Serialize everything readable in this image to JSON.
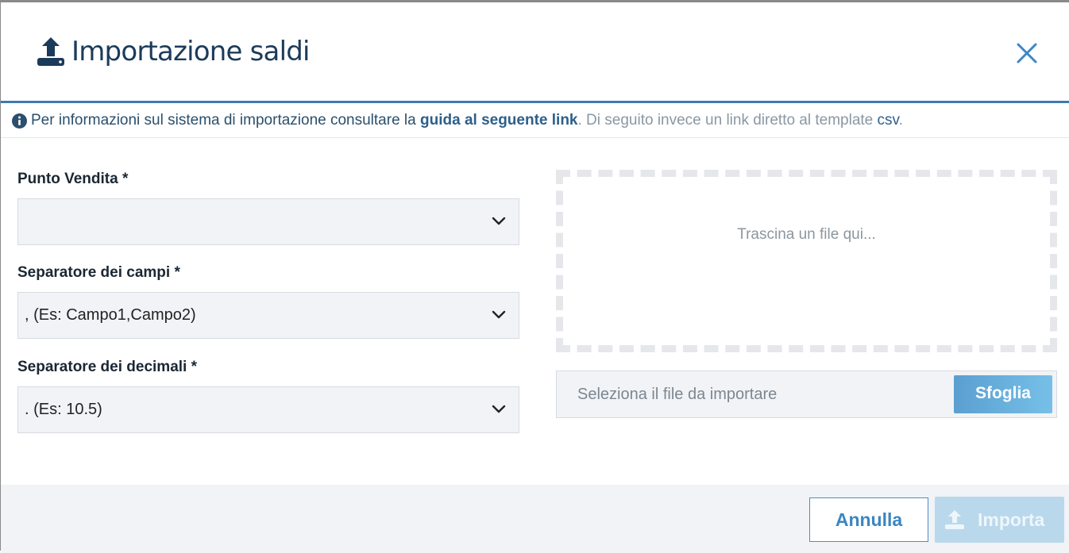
{
  "dialog": {
    "title": "Importazione saldi",
    "close_icon": "close-icon",
    "title_icon": "upload-icon"
  },
  "info": {
    "prefix": "Per informazioni sul sistema di importazione consultare la ",
    "link_text": "guida al seguente link",
    "middle": ". Di seguito invece un link diretto al template ",
    "csv_link": "csv",
    "suffix": "."
  },
  "form": {
    "punto_vendita": {
      "label": "Punto Vendita *",
      "value": ""
    },
    "separatore_campi": {
      "label": "Separatore dei campi *",
      "value": ", (Es: Campo1,Campo2)"
    },
    "separatore_decimali": {
      "label": "Separatore dei decimali *",
      "value": ". (Es: 10.5)"
    }
  },
  "upload": {
    "dropzone_hint": "Trascina un file qui...",
    "file_placeholder": "Seleziona il file da importare",
    "browse_label": "Sfoglia"
  },
  "footer": {
    "cancel_label": "Annulla",
    "import_label": "Importa"
  },
  "colors": {
    "accent": "#3d7ab3",
    "title": "#1c3b5a",
    "import_disabled": "#b9d8ec"
  }
}
